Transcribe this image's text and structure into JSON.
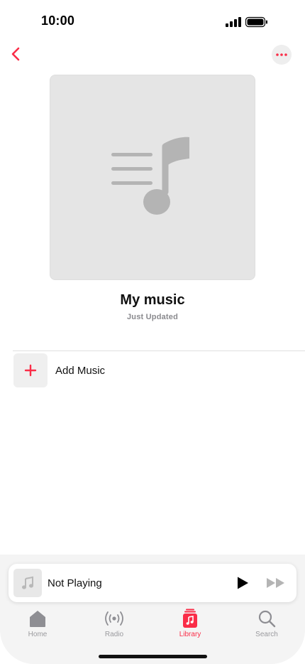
{
  "status_bar": {
    "time": "10:00"
  },
  "colors": {
    "accent": "#fa2d48",
    "icon_gray": "#9a9a9e",
    "artwork_bg": "#e5e5e5"
  },
  "header": {
    "back_icon": "chevron-left-icon",
    "more_icon": "ellipsis-icon"
  },
  "playlist": {
    "title": "My music",
    "subtitle": "Just Updated",
    "artwork_icon": "music-note-list-icon"
  },
  "actions": {
    "add_music_label": "Add Music",
    "add_icon": "plus-icon"
  },
  "mini_player": {
    "title": "Not Playing",
    "art_icon": "music-note-icon",
    "play_icon": "play-icon",
    "forward_icon": "fast-forward-icon"
  },
  "tabs": [
    {
      "label": "Home",
      "icon": "home-icon",
      "active": false
    },
    {
      "label": "Radio",
      "icon": "radio-icon",
      "active": false
    },
    {
      "label": "Library",
      "icon": "library-icon",
      "active": true
    },
    {
      "label": "Search",
      "icon": "search-icon",
      "active": false
    }
  ]
}
